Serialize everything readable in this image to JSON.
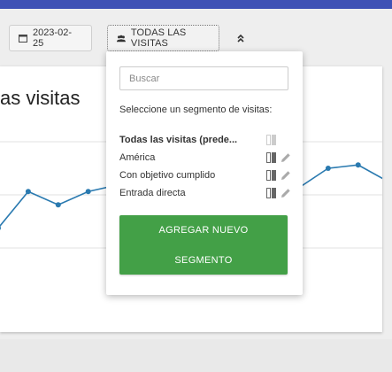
{
  "toolbar": {
    "date_label": "2023-02-25",
    "segment_label": "TODAS LAS VISITAS"
  },
  "card": {
    "title": "as visitas"
  },
  "dropdown": {
    "search_placeholder": "Buscar",
    "hint": "Seleccione un segmento de visitas:",
    "segments": [
      {
        "label": "Todas las visitas (prede...",
        "bold": true,
        "editable": false,
        "compare_icon": "compare-icon-disabled"
      },
      {
        "label": "América",
        "bold": false,
        "editable": true,
        "compare_icon": "compare-icon"
      },
      {
        "label": "Con objetivo cumplido",
        "bold": false,
        "editable": true,
        "compare_icon": "compare-icon"
      },
      {
        "label": "Entrada directa",
        "bold": false,
        "editable": true,
        "compare_icon": "compare-icon"
      }
    ],
    "add_button_line1": "AGREGAR NUEVO",
    "add_button_line2": "SEGMENTO"
  },
  "colors": {
    "accent": "#3f51b5",
    "add_button": "#43a047",
    "series": "#2a7ab0"
  },
  "chart_data": {
    "type": "line",
    "series": [
      {
        "values": [
          6,
          17,
          13,
          17,
          19,
          14,
          21,
          17,
          19,
          20,
          18,
          24,
          25,
          20
        ]
      }
    ],
    "grid": true
  }
}
